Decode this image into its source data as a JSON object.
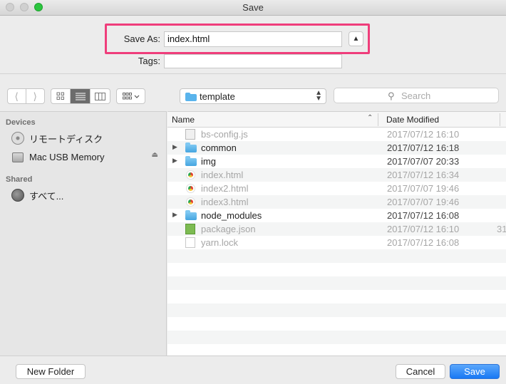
{
  "window": {
    "title": "Save"
  },
  "header": {
    "save_as_label": "Save As:",
    "save_as_value": "index.html",
    "tags_label": "Tags:",
    "tags_value": ""
  },
  "toolbar": {
    "back_icon": "chevron-left-icon",
    "forward_icon": "chevron-right-icon",
    "view_modes": [
      "icon-view",
      "list-view",
      "column-view"
    ],
    "active_view": "list-view",
    "location": "template",
    "search_placeholder": "Search"
  },
  "sidebar": {
    "devices_heading": "Devices",
    "devices": [
      {
        "label": "リモートディスク",
        "icon": "disc-icon"
      },
      {
        "label": "Mac USB Memory",
        "icon": "usb-drive-icon",
        "ejectable": true
      }
    ],
    "shared_heading": "Shared",
    "shared": [
      {
        "label": "すべて...",
        "icon": "network-globe-icon"
      }
    ]
  },
  "list": {
    "columns": {
      "name": "Name",
      "date": "Date Modified"
    },
    "rows": [
      {
        "name": "bs-config.js",
        "date": "2017/07/12 16:10",
        "kind": "js",
        "folder": false
      },
      {
        "name": "common",
        "date": "2017/07/12 16:18",
        "kind": "folder",
        "folder": true
      },
      {
        "name": "img",
        "date": "2017/07/07 20:33",
        "kind": "folder",
        "folder": true
      },
      {
        "name": "index.html",
        "date": "2017/07/12 16:34",
        "kind": "html",
        "folder": false
      },
      {
        "name": "index2.html",
        "date": "2017/07/07 19:46",
        "kind": "html",
        "folder": false
      },
      {
        "name": "index3.html",
        "date": "2017/07/07 19:46",
        "kind": "html",
        "folder": false
      },
      {
        "name": "node_modules",
        "date": "2017/07/12 16:08",
        "kind": "folder",
        "folder": true
      },
      {
        "name": "package.json",
        "date": "2017/07/12 16:10",
        "kind": "json",
        "folder": false,
        "size_fragment": "31"
      },
      {
        "name": "yarn.lock",
        "date": "2017/07/12 16:08",
        "kind": "doc",
        "folder": false
      }
    ]
  },
  "buttons": {
    "new_folder": "New Folder",
    "cancel": "Cancel",
    "save": "Save"
  },
  "colors": {
    "highlight": "#ef3d7b",
    "primary_button": "#1878f4",
    "folder": "#45a5e0"
  }
}
